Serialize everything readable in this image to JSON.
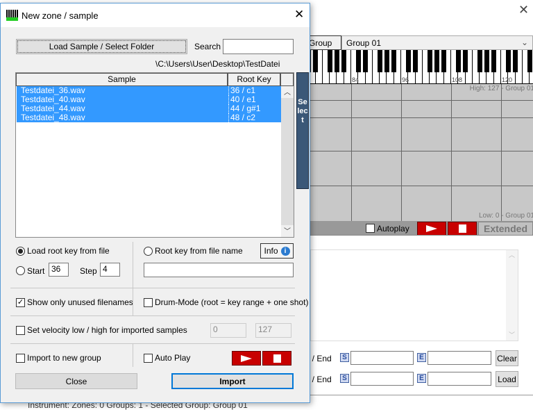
{
  "background": {
    "group_button": "Group",
    "group_select": "Group 01",
    "octave_labels": [
      "84",
      "96",
      "108",
      "120"
    ],
    "high_label": "High: 127 - Group 01",
    "low_label": "Low: 0 - Group 01",
    "autoplay_label": "Autoplay",
    "autoplay_checked": false,
    "extended_label": "Extended",
    "start_end_label": "Start / End",
    "s_icon": "S",
    "e_icon": "E",
    "clear_label": "Clear",
    "load_label": "Load",
    "status": "Instrument:   Zones: 0   Groups: 1    -    Selected Group: Group 01",
    "accent_red": "#c80000"
  },
  "dialog": {
    "title": "New zone / sample",
    "load_button": "Load Sample / Select Folder",
    "search_label": "Search",
    "search_value": "",
    "path": "C:\\Users\\User\\Desktop\\TestDatei\\",
    "columns": [
      "Sample",
      "Root Key"
    ],
    "rows": [
      {
        "sample": "Testdatei_36.wav",
        "root": "36 / c1"
      },
      {
        "sample": "Testdatei_40.wav",
        "root": "40 / e1"
      },
      {
        "sample": "Testdatei_44.wav",
        "root": "44 / g#1"
      },
      {
        "sample": "Testdatei_48.wav",
        "root": "48 / c2"
      }
    ],
    "select_button": "Select",
    "load_root_key_label": "Load root key from file",
    "start_label": "Start",
    "start_value": "36",
    "step_label": "Step",
    "step_value": "4",
    "root_from_name_label": "Root key from file name",
    "root_from_name_value": "",
    "info_button": "Info",
    "show_unused_label": "Show only unused filenames",
    "show_unused_checked": true,
    "drum_mode_label": "Drum-Mode (root = key range + one shot)",
    "drum_mode_checked": false,
    "velocity_label": "Set velocity low / high for imported samples",
    "velocity_checked": false,
    "velocity_low": "0",
    "velocity_high": "127",
    "import_new_group_label": "Import to new group",
    "auto_play_label": "Auto Play",
    "close_button": "Close",
    "import_button": "Import",
    "selection_color": "#3399ff"
  }
}
